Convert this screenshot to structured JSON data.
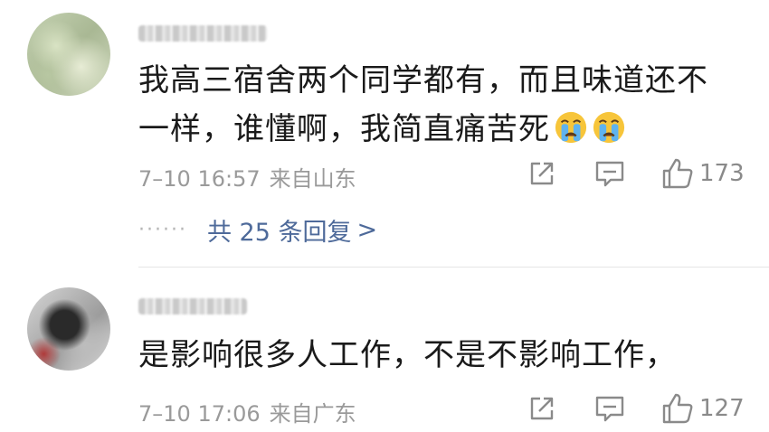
{
  "comments": [
    {
      "text_line1": "我高三宿舍两个同学都有，而且味道还不",
      "text_line2": "一样，谁懂啊，我简直痛苦死",
      "emoji": [
        "crying-face",
        "crying-face"
      ],
      "time": "7–10 16:57",
      "location": "来自山东",
      "likes": "173",
      "replies_label": "共 25 条回复",
      "replies_arrow": ">",
      "dots": "······"
    },
    {
      "text_line1": "是影响很多人工作，不是不影响工作，",
      "time": "7–10 17:06",
      "location": "来自广东",
      "likes": "127"
    }
  ],
  "icons": {
    "share": "share-icon",
    "reply": "reply-icon",
    "like": "thumbs-up-icon"
  },
  "colors": {
    "text": "#1a1a1a",
    "meta": "#9a9a9a",
    "link": "#4e6a9a",
    "icon": "#8a8a8a",
    "divider": "#e6e6e6"
  }
}
